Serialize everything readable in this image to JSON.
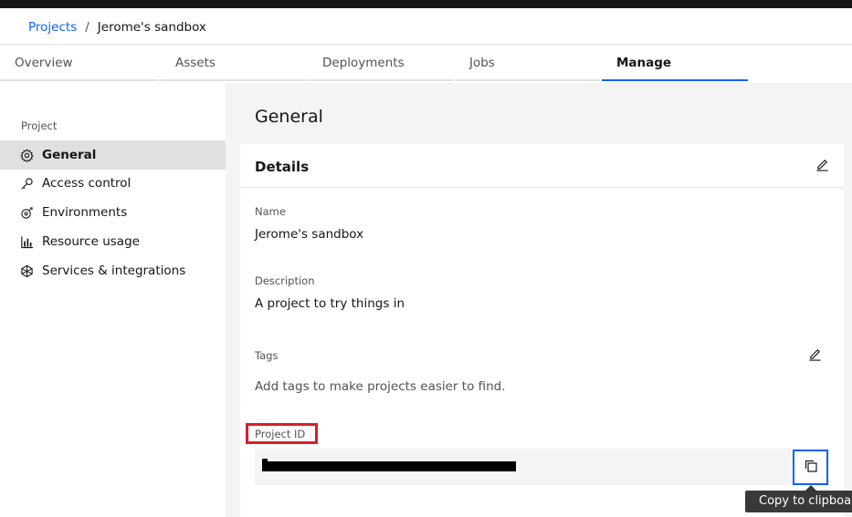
{
  "breadcrumb": {
    "root": "Projects",
    "separator": "/",
    "current": "Jerome's sandbox"
  },
  "tabs": [
    "Overview",
    "Assets",
    "Deployments",
    "Jobs",
    "Manage"
  ],
  "active_tab": "Manage",
  "sidebar": {
    "heading": "Project",
    "items": [
      {
        "label": "General",
        "icon": "settings-icon"
      },
      {
        "label": "Access control",
        "icon": "key-icon"
      },
      {
        "label": "Environments",
        "icon": "environment-icon"
      },
      {
        "label": "Resource usage",
        "icon": "bar-chart-icon"
      },
      {
        "label": "Services & integrations",
        "icon": "integrations-icon"
      }
    ]
  },
  "main": {
    "title": "General",
    "details": {
      "title": "Details",
      "name_label": "Name",
      "name_value": "Jerome's sandbox",
      "description_label": "Description",
      "description_value": "A project to try things in",
      "tags_label": "Tags",
      "tags_placeholder": "Add tags to make projects easier to find.",
      "project_id_label": "Project ID"
    }
  },
  "tooltip": {
    "text": "Copy to clipboard"
  },
  "colors": {
    "link": "#0f62fe",
    "active_tab_border": "#0f62fe",
    "highlight": "#da1e28",
    "tooltip_bg": "#393939"
  }
}
